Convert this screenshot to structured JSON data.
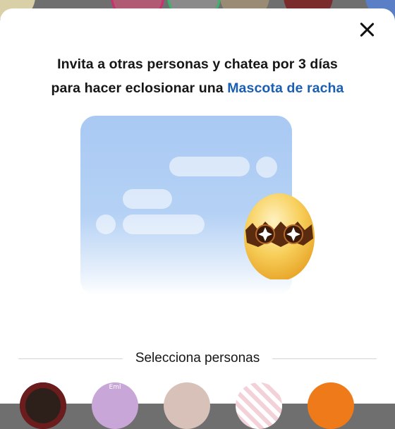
{
  "dialog": {
    "title_line1": "Invita a otras personas y chatea por 3 días",
    "title_line2_prefix": "para hacer eclosionar una ",
    "title_line2_highlight": "Mascota de racha"
  },
  "section": {
    "select_label": "Selecciona personas"
  },
  "colors": {
    "accent": "#1a5fb4",
    "card_blue": "#a9c9f3",
    "egg": "#f5c24a"
  },
  "people": [
    {
      "avatar_label": "",
      "color": "#3a2a24"
    },
    {
      "avatar_label": "Eml",
      "color": "#c9a6d8"
    },
    {
      "avatar_label": "",
      "color": "#d8c3bb"
    },
    {
      "avatar_label": "",
      "color": "#f0c9d2"
    },
    {
      "avatar_label": "",
      "color": "#ef7a1a"
    }
  ]
}
